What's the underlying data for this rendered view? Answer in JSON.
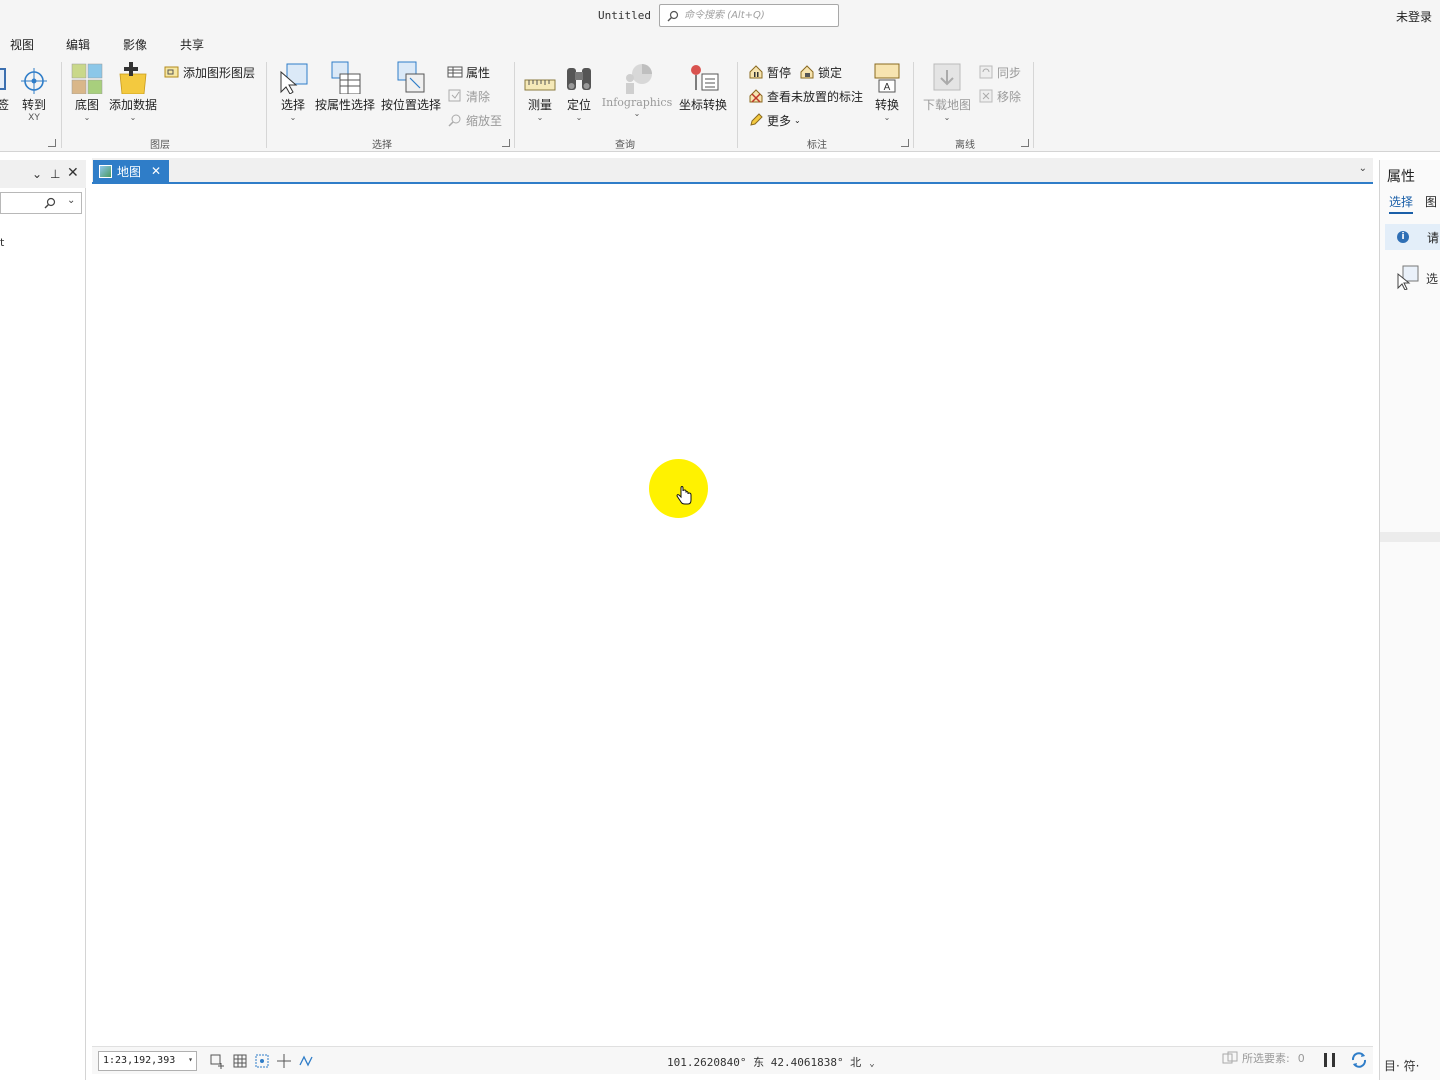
{
  "titlebar": {
    "title": "Untitled",
    "search_placeholder": "命令搜索 (Alt+Q)",
    "signin": "未登录"
  },
  "menu": {
    "tabs": [
      "视图",
      "编辑",
      "影像",
      "共享"
    ]
  },
  "ribbon": {
    "nav": {
      "bookmark_label": "签",
      "goto_xy_label": "转到",
      "goto_xy_sub": "XY"
    },
    "layer": {
      "group_label": "图层",
      "basemap_label": "底图",
      "add_data_label": "添加数据",
      "add_graphics_layer_label": "添加图形图层"
    },
    "selection": {
      "group_label": "选择",
      "select_label": "选择",
      "select_by_attr_label": "按属性选择",
      "select_by_loc_label": "按位置选择",
      "attributes_label": "属性",
      "clear_label": "清除",
      "zoom_to_label": "缩放至"
    },
    "inquiry": {
      "group_label": "查询",
      "measure_label": "测量",
      "locate_label": "定位",
      "infographics_label": "Infographics",
      "convert_coords_label": "坐标转换"
    },
    "labeling": {
      "group_label": "标注",
      "pause_label": "暂停",
      "lock_label": "锁定",
      "view_unplaced_label": "查看未放置的标注",
      "more_label": "更多",
      "convert_label": "转换"
    },
    "offline": {
      "group_label": "离线",
      "download_map_label": "下载地图",
      "sync_label": "同步",
      "remove_label": "移除"
    }
  },
  "leftpane": {
    "item_label": "t"
  },
  "mapview": {
    "tab_label": "地图",
    "scale": "1:23,192,393",
    "coordinates": "101.2620840° 东 42.4061838° 北"
  },
  "rightpane": {
    "title": "属性",
    "tabs": [
      "选择",
      "图"
    ],
    "info_text": "请",
    "select_label": "选",
    "bottom_label": "目· 符·"
  },
  "status": {
    "selected_features_label": "所选要素:",
    "selected_features_count": "0"
  },
  "colors": {
    "accent": "#2f7dc8",
    "cursor_highlight": "#fff200"
  }
}
